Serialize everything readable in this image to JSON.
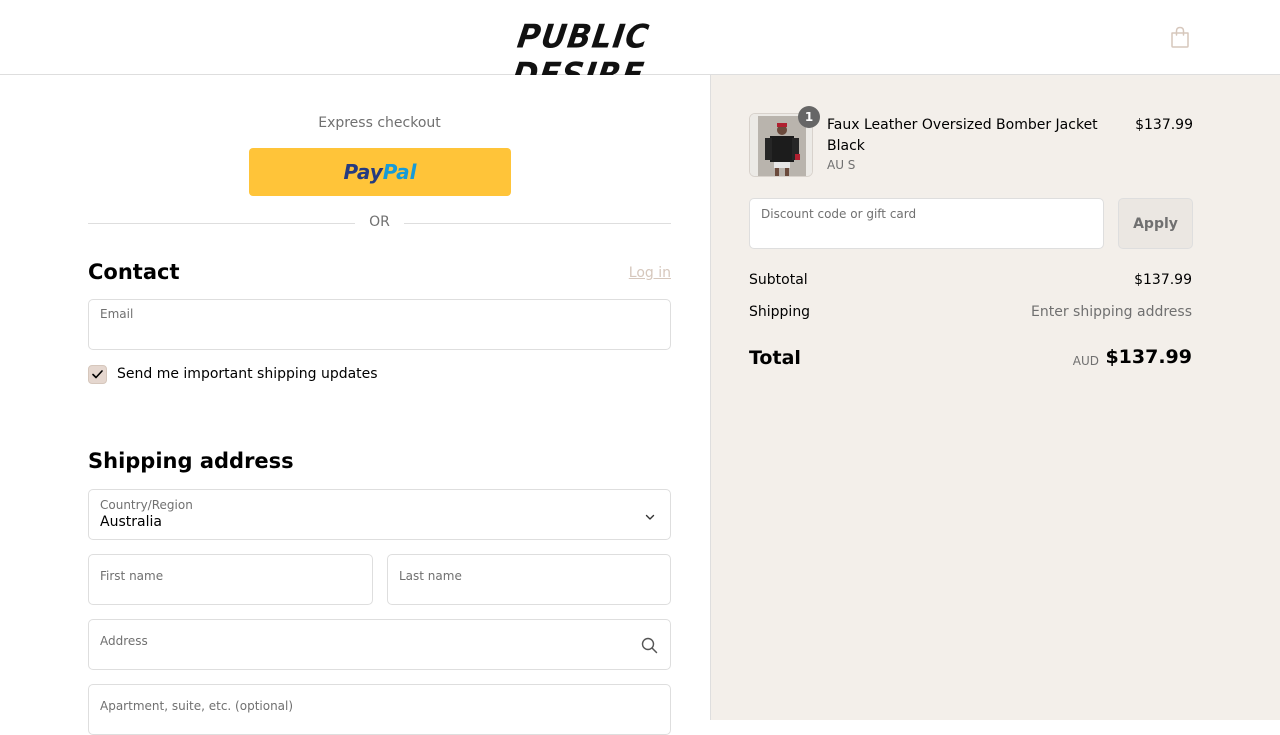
{
  "header": {
    "logo_text": "PUBLIC DESIRE",
    "logo_mark": "®",
    "cart_icon": "shopping-bag-icon"
  },
  "express": {
    "title": "Express checkout",
    "paypal_pay": "Pay",
    "paypal_pal": "Pal",
    "or_text": "OR"
  },
  "contact": {
    "heading": "Contact",
    "login_label": "Log in",
    "email_label": "Email",
    "email_value": "",
    "updates_label": "Send me important shipping updates",
    "updates_checked": true
  },
  "shipping": {
    "heading": "Shipping address",
    "country_label": "Country/Region",
    "country_value": "Australia",
    "first_name_label": "First name",
    "last_name_label": "Last name",
    "address_label": "Address",
    "apartment_label": "Apartment, suite, etc. (optional)"
  },
  "order": {
    "items": [
      {
        "name": "Faux Leather Oversized Bomber Jacket Black",
        "variant": "AU S",
        "price": "$137.99",
        "quantity": "1"
      }
    ],
    "discount_placeholder": "Discount code or gift card",
    "apply_label": "Apply",
    "subtotal_label": "Subtotal",
    "subtotal_value": "$137.99",
    "shipping_label": "Shipping",
    "shipping_value": "Enter shipping address",
    "total_label": "Total",
    "total_currency": "AUD",
    "total_value": "$137.99"
  },
  "colors": {
    "accent": "#d6c7bc",
    "paypal_yellow": "#ffc439",
    "summary_bg": "#f3efea"
  }
}
